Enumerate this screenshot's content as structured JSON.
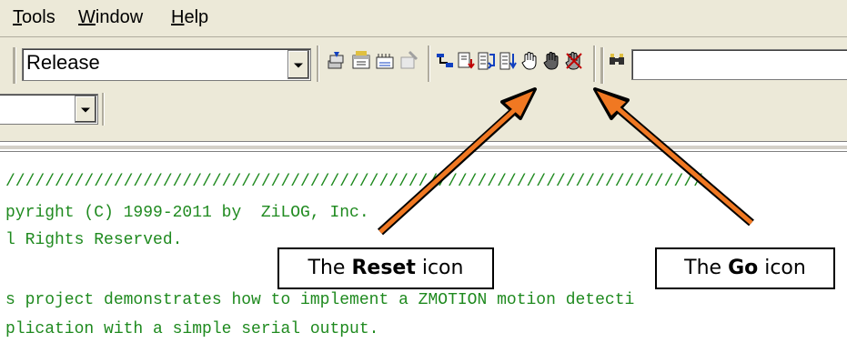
{
  "menu": {
    "tools_ul": "T",
    "tools_rest": "ools",
    "window_ul": "W",
    "window_rest": "indow",
    "help_ul": "H",
    "help_rest": "elp"
  },
  "toolbar": {
    "configuration_value": "Release",
    "icons": [
      "build-all-icon",
      "build-icon",
      "rebuild-icon",
      "stop-build-icon",
      "step-into-icon",
      "step-over-icon",
      "reset-icon",
      "go-icon",
      "break-icon",
      "insert-breakpoint-icon",
      "remove-breakpoints-icon",
      "find-in-files-icon"
    ]
  },
  "code": {
    "lines": [
      "///////////////////////////////////////////////////////////////////////",
      "pyright (C) 1999-2011 by  ZiLOG, Inc.",
      "l Rights Reserved.",
      "",
      "s project demonstrates how to implement a ZMOTION motion detecti",
      "plication with a simple serial output."
    ],
    "color": "#1f8a1f"
  },
  "annotations": {
    "reset_prefix": "The ",
    "reset_bold": "Reset",
    "reset_suffix": " icon",
    "go_prefix": "The ",
    "go_bold": "Go",
    "go_suffix": " icon",
    "arrow_color": "#f07822"
  }
}
